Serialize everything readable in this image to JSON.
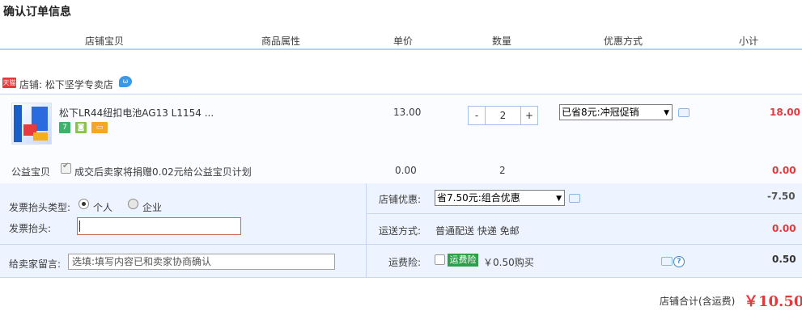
{
  "page": {
    "title": "确认订单信息"
  },
  "table_header": [
    "店铺宝贝",
    "商品属性",
    "单价",
    "数量",
    "优惠方式",
    "小计"
  ],
  "shop": {
    "badge": "天猫",
    "label": "店铺: 松下坚学专卖店",
    "chat_icon": "wangwang-icon"
  },
  "item": {
    "name": "松下LR44纽扣电池AG13 L1154 ...",
    "icons": [
      "7-day-return-icon",
      "guarantee-icon",
      "credit-card-icon"
    ],
    "icon_texts": [
      "7",
      "◙",
      "▭"
    ],
    "price": "13.00",
    "qty_minus": "-",
    "quantity": "2",
    "qty_plus": "+",
    "promo": "已省8元:冲冠促销",
    "subtotal": "18.00"
  },
  "charity": {
    "label": "公益宝贝",
    "text": "成交后卖家将捐赠0.02元给公益宝贝计划",
    "price": "0.00",
    "quantity": "2",
    "subtotal": "0.00"
  },
  "invoice": {
    "type_label": "发票抬头类型:",
    "option_personal": "个人",
    "option_company": "企业",
    "title_label": "发票抬头:",
    "title_value": ""
  },
  "message": {
    "label": "给卖家留言:",
    "placeholder": "选填:填写内容已和卖家协商确认"
  },
  "shop_discount": {
    "label": "店铺优惠:",
    "value": "省7.50元:组合优惠",
    "amount": "-7.50"
  },
  "shipping": {
    "label": "运送方式:",
    "value": "普通配送 快递 免邮",
    "amount": "0.00"
  },
  "insurance": {
    "label": "运费险:",
    "badge": "运费险",
    "text": "￥0.50购买",
    "amount": "0.50"
  },
  "total": {
    "label": "店铺合计(含运费)",
    "value": "￥10.50"
  },
  "colors": {
    "accent_red": "#e4393c",
    "header_line": "#b2d1ff",
    "panel_bg": "#eef4ff",
    "insurance_green": "#2e9e4a"
  }
}
